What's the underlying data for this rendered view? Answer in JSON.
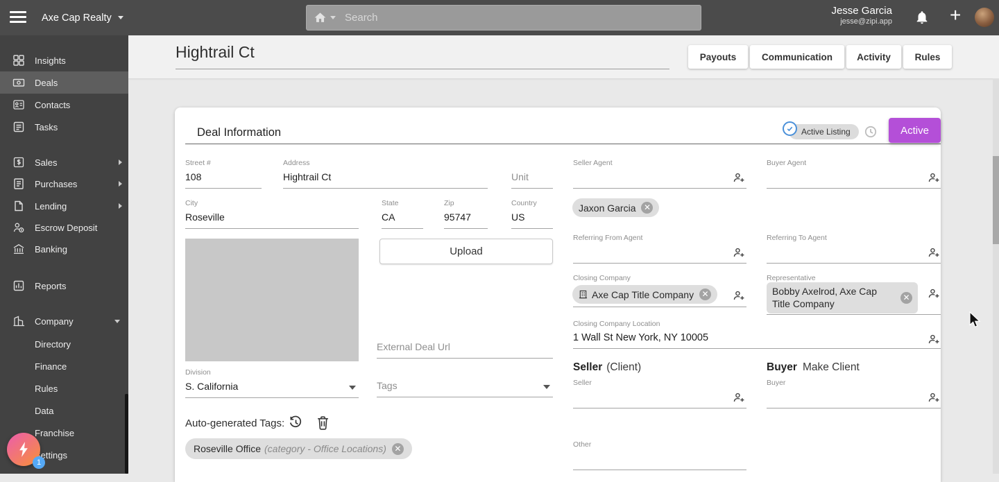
{
  "colors": {
    "accent_purple": "#b44fd8",
    "toggle_blue": "#4a90d9",
    "badge_blue": "#55a9f6",
    "fab_gradient_start": "#ec5fa8",
    "fab_gradient_end": "#f78e3d",
    "chip_gray": "#dedede"
  },
  "topbar": {
    "company_name": "Axe Cap Realty",
    "search_placeholder": "Search",
    "user_name": "Jesse Garcia",
    "user_email": "jesse@zipi.app"
  },
  "sidebar": {
    "items": [
      {
        "label": "Insights"
      },
      {
        "label": "Deals"
      },
      {
        "label": "Contacts"
      },
      {
        "label": "Tasks"
      },
      {
        "label": "Sales"
      },
      {
        "label": "Purchases"
      },
      {
        "label": "Lending"
      },
      {
        "label": "Escrow Deposit"
      },
      {
        "label": "Banking"
      },
      {
        "label": "Reports"
      },
      {
        "label": "Company"
      }
    ],
    "company_children": [
      {
        "label": "Directory"
      },
      {
        "label": "Finance"
      },
      {
        "label": "Rules"
      },
      {
        "label": "Data"
      },
      {
        "label": "Franchise"
      },
      {
        "label": "Settings"
      }
    ],
    "fab_badge": "1"
  },
  "header": {
    "title": "Hightrail Ct",
    "buttons": [
      {
        "label": "Payouts"
      },
      {
        "label": "Communication"
      },
      {
        "label": "Activity"
      },
      {
        "label": "Rules"
      }
    ]
  },
  "deal": {
    "section_title": "Deal Information",
    "listing_toggle_label": "Active Listing",
    "status_button_label": "Active",
    "address": {
      "street_label": "Street #",
      "street_value": "108",
      "address_label": "Address",
      "address_value": "Hightrail Ct",
      "unit_placeholder": "Unit",
      "city_label": "City",
      "city_value": "Roseville",
      "state_label": "State",
      "state_value": "CA",
      "zip_label": "Zip",
      "zip_value": "95747",
      "country_label": "Country",
      "country_value": "US"
    },
    "upload_button_label": "Upload",
    "external_url_placeholder": "External Deal Url",
    "division_label": "Division",
    "division_value": "S. California",
    "tags_placeholder": "Tags",
    "auto_tags_label": "Auto-generated Tags:",
    "auto_tag_chip": {
      "name": "Roseville Office",
      "detail": "(category - Office Locations)"
    },
    "agents": {
      "seller_agent_label": "Seller Agent",
      "seller_agent_chip": "Jaxon Garcia",
      "buyer_agent_label": "Buyer Agent",
      "referring_from_label": "Referring From Agent",
      "referring_to_label": "Referring To Agent"
    },
    "closing": {
      "company_label": "Closing Company",
      "company_chip": "Axe Cap Title Company",
      "representative_label": "Representative",
      "representative_chip": "Bobby Axelrod, Axe Cap Title Company",
      "location_label": "Closing Company Location",
      "location_value": "1 Wall St New York, NY 10005"
    },
    "clients": {
      "seller_heading": "Seller",
      "seller_heading_note": "(Client)",
      "buyer_heading": "Buyer",
      "buyer_heading_action": "Make Client",
      "seller_label": "Seller",
      "buyer_label": "Buyer",
      "other_label": "Other"
    }
  }
}
